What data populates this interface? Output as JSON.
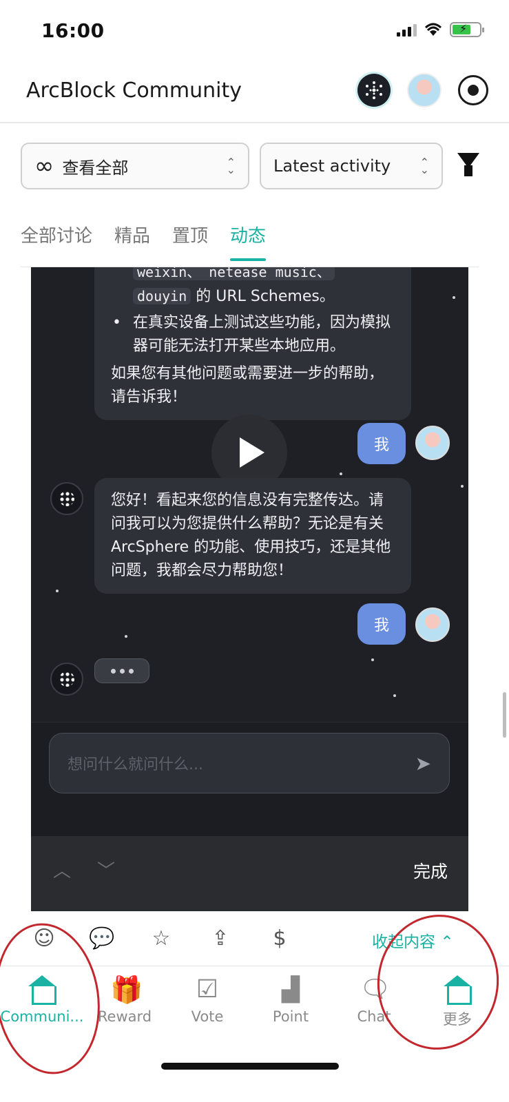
{
  "status_bar": {
    "time": "16:00"
  },
  "header": {
    "title": "ArcBlock Community"
  },
  "filters": {
    "scope_label": "查看全部",
    "sort_label": "Latest activity"
  },
  "tabs": [
    {
      "label": "全部讨论",
      "active": false
    },
    {
      "label": "精品",
      "active": false
    },
    {
      "label": "置顶",
      "active": false
    },
    {
      "label": "动态",
      "active": true
    }
  ],
  "chat": {
    "top_message": {
      "code_line1": "weixin、 netease music、",
      "code_douyin": "douyin",
      "line_after_code": " 的 URL Schemes。",
      "bullet": "在真实设备上测试这些功能，因为模拟器可能无法打开某些本地应用。",
      "closing": "如果您有其他问题或需要进一步的帮助，请告诉我！"
    },
    "me_label_1": "我",
    "ai_reply": "您好！看起来您的信息没有完整传达。请问我可以为您提供什么帮助？无论是有关 ArcSphere 的功能、使用技巧，还是其他问题，我都会尽力帮助您！",
    "me_label_2": "我",
    "input_placeholder": "想问什么就问什么...",
    "keyboard_done": "完成"
  },
  "actions": {
    "collapse_label": "收起内容"
  },
  "bottom_nav": [
    {
      "label": "Communi...",
      "icon": "home-icon",
      "active": true
    },
    {
      "label": "Reward",
      "icon": "gift-icon",
      "active": false
    },
    {
      "label": "Vote",
      "icon": "vote-icon",
      "active": false
    },
    {
      "label": "Point",
      "icon": "podium-icon",
      "active": false
    },
    {
      "label": "Chat",
      "icon": "chat-icon",
      "active": false
    },
    {
      "label": "更多",
      "icon": "home-icon",
      "active": false
    }
  ],
  "colors": {
    "accent": "#19b2a3",
    "chat_bg": "#1e2026",
    "me_bubble": "#6a8fe0",
    "annotation": "#c1272d"
  }
}
